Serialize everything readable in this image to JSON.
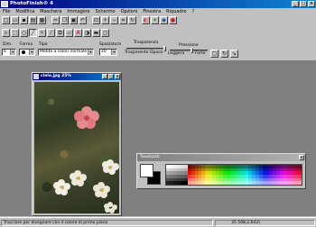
{
  "app": {
    "title": "PhotoFinish® 4"
  },
  "menu": [
    "File",
    "Modifica",
    "Maschera",
    "Immagine",
    "Schermo",
    "Opzioni",
    "Finestra",
    "Riquadro",
    "?"
  ],
  "toolbar1_icons": [
    "new-icon",
    "open-icon",
    "save-icon",
    "print-icon",
    "scan-icon",
    "cut-icon",
    "copy-icon",
    "paste-icon",
    "undo-icon",
    "zoom-fit-icon",
    "zoom-in-icon",
    "zoom-out-icon",
    "crop-icon",
    "rotate-icon",
    "color-icon",
    "filter-icon",
    "effect-icon",
    "mask-icon"
  ],
  "toolbar2_icons": [
    "zoom-icon",
    "select-rect-icon",
    "lasso-icon",
    "brush-icon",
    "magic-wand-icon",
    "eyedropper-icon",
    "clone-icon",
    "eraser-icon",
    "text-icon",
    "sharpen-icon",
    "fill-icon",
    "shape-icon"
  ],
  "options": {
    "size_label": "Dim.",
    "size_value": "6",
    "shape_label": "Forma",
    "type_label": "Tipo",
    "type_value": "Matita a colori normale",
    "spacing_label": "Spaziatura",
    "spacing_value": "20",
    "transparency_label": "Trasparenza",
    "transparency_left": "Trasparente",
    "transparency_right": "Opaco",
    "pressure_label": "Pressione",
    "pressure_left": "Leggera",
    "pressure_right": "Forte",
    "transparency_level": 1.0,
    "pressure_level": 0.6
  },
  "image_window": {
    "title": "cielo.jpg  25%"
  },
  "palette": {
    "title": "Tavolozza",
    "fg_color": "#ffffff",
    "bg_color": "#000000"
  },
  "status": {
    "hint": "Tracciare per disegnare con il colore di primo piano",
    "coords": "35 508,2,642)"
  }
}
